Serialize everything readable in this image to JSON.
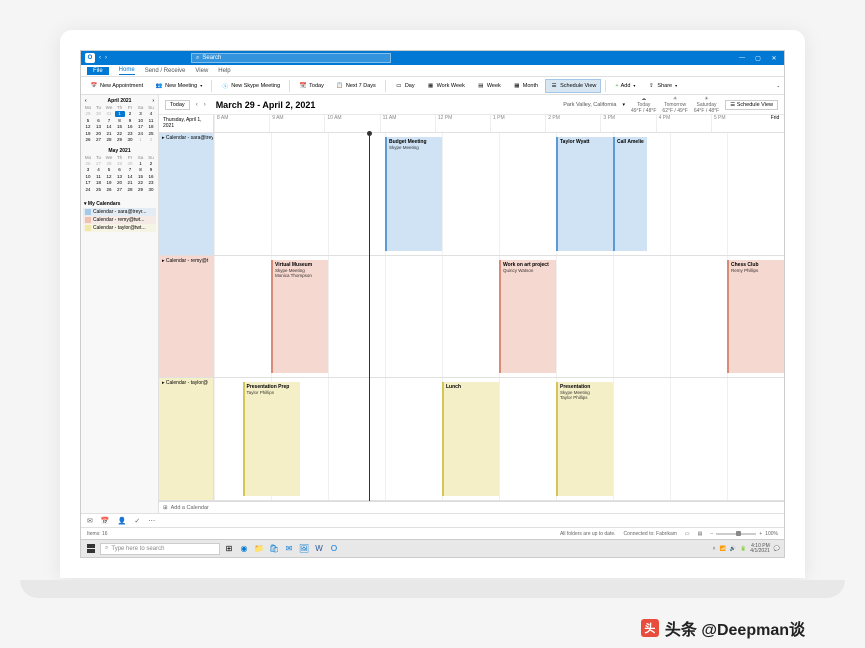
{
  "titlebar": {
    "search_placeholder": "Search"
  },
  "tabs": {
    "file": "File",
    "home": "Home",
    "send_receive": "Send / Receive",
    "view": "View",
    "help": "Help"
  },
  "ribbon": {
    "new_appointment": "New Appointment",
    "new_meeting": "New Meeting",
    "new_skype": "New Skype Meeting",
    "today": "Today",
    "next7": "Next 7 Days",
    "day": "Day",
    "work_week": "Work Week",
    "week": "Week",
    "month": "Month",
    "schedule_view": "Schedule View",
    "add": "Add",
    "share": "Share"
  },
  "minical1": {
    "title": "April 2021",
    "dow": [
      "Mo",
      "Tu",
      "We",
      "Th",
      "Fr",
      "Sa",
      "Su"
    ],
    "days": [
      {
        "n": "29",
        "dim": true
      },
      {
        "n": "30",
        "dim": true
      },
      {
        "n": "31",
        "dim": true
      },
      {
        "n": "1",
        "sel": true
      },
      {
        "n": "2"
      },
      {
        "n": "3"
      },
      {
        "n": "4"
      },
      {
        "n": "5"
      },
      {
        "n": "6"
      },
      {
        "n": "7"
      },
      {
        "n": "8"
      },
      {
        "n": "9"
      },
      {
        "n": "10"
      },
      {
        "n": "11"
      },
      {
        "n": "12"
      },
      {
        "n": "13"
      },
      {
        "n": "14"
      },
      {
        "n": "15"
      },
      {
        "n": "16"
      },
      {
        "n": "17"
      },
      {
        "n": "18"
      },
      {
        "n": "19"
      },
      {
        "n": "20"
      },
      {
        "n": "21"
      },
      {
        "n": "22"
      },
      {
        "n": "23"
      },
      {
        "n": "24"
      },
      {
        "n": "25"
      },
      {
        "n": "26"
      },
      {
        "n": "27"
      },
      {
        "n": "28"
      },
      {
        "n": "29"
      },
      {
        "n": "30"
      },
      {
        "n": "1",
        "dim": true
      },
      {
        "n": "2",
        "dim": true
      }
    ]
  },
  "minical2": {
    "title": "May 2021",
    "dow": [
      "Mo",
      "Tu",
      "We",
      "Th",
      "Fr",
      "Sa",
      "Su"
    ],
    "days": [
      {
        "n": "26",
        "dim": true
      },
      {
        "n": "27",
        "dim": true
      },
      {
        "n": "28",
        "dim": true
      },
      {
        "n": "29",
        "dim": true
      },
      {
        "n": "30",
        "dim": true
      },
      {
        "n": "1"
      },
      {
        "n": "2"
      },
      {
        "n": "3"
      },
      {
        "n": "4"
      },
      {
        "n": "5"
      },
      {
        "n": "6"
      },
      {
        "n": "7"
      },
      {
        "n": "8"
      },
      {
        "n": "9"
      },
      {
        "n": "10"
      },
      {
        "n": "11"
      },
      {
        "n": "12"
      },
      {
        "n": "13"
      },
      {
        "n": "14"
      },
      {
        "n": "15"
      },
      {
        "n": "16"
      },
      {
        "n": "17"
      },
      {
        "n": "18"
      },
      {
        "n": "19"
      },
      {
        "n": "20"
      },
      {
        "n": "21"
      },
      {
        "n": "22"
      },
      {
        "n": "23"
      },
      {
        "n": "24"
      },
      {
        "n": "25"
      },
      {
        "n": "26"
      },
      {
        "n": "27"
      },
      {
        "n": "28"
      },
      {
        "n": "29"
      },
      {
        "n": "30"
      }
    ]
  },
  "mycals": {
    "title": "My Calendars",
    "items": [
      {
        "label": "Calendar - sara@treyr...",
        "color": "#a5c8e8"
      },
      {
        "label": "Calendar - remy@twt...",
        "color": "#f0c0b0"
      },
      {
        "label": "Calendar - taylor@twt...",
        "color": "#f0e8a8"
      }
    ]
  },
  "main_head": {
    "today": "Today",
    "date_range": "March 29 - April 2, 2021",
    "current_day": "Thursday, April 1, 2021",
    "location": "Park Valley, California",
    "weather": [
      {
        "label": "Today",
        "temp": "49°F / 48°F",
        "icon": "☁"
      },
      {
        "label": "Tomorrow",
        "temp": "62°F / 49°F",
        "icon": "☀"
      },
      {
        "label": "Saturday",
        "temp": "64°F / 48°F",
        "icon": "☀"
      }
    ],
    "schedule_view": "Schedule View",
    "friday": "Frid"
  },
  "hours": [
    "8 AM",
    "9 AM",
    "10 AM",
    "11 AM",
    "12 PM",
    "1 PM",
    "2 PM",
    "3 PM",
    "4 PM",
    "5 PM"
  ],
  "rows": [
    {
      "label": "Calendar - sara@treyr",
      "color": "blue",
      "events": [
        {
          "title": "Budget Meeting",
          "sub": "Skype Meeting",
          "start": 3,
          "span": 1,
          "color": "blue"
        },
        {
          "title": "Taylor Wyatt",
          "sub": "",
          "start": 6,
          "span": 1,
          "color": "blue"
        },
        {
          "title": "Call Amelie",
          "sub": "",
          "start": 7,
          "span": 0.6,
          "color": "blue"
        }
      ]
    },
    {
      "label": "Calendar - remy@t",
      "color": "pink",
      "events": [
        {
          "title": "Virtual Museum",
          "sub": "Skype Meeting\nMonica Thompson",
          "start": 1,
          "span": 1,
          "color": "pink"
        },
        {
          "title": "Work on art project",
          "sub": "Quincy Watson",
          "start": 5,
          "span": 1,
          "color": "pink"
        },
        {
          "title": "Chess Club",
          "sub": "Remy Phillips",
          "start": 9,
          "span": 1,
          "color": "pink"
        }
      ]
    },
    {
      "label": "Calendar - taylor@",
      "color": "yellow",
      "events": [
        {
          "title": "Presentation Prep",
          "sub": "Taylor Phillips",
          "start": 0.5,
          "span": 1,
          "color": "yellow"
        },
        {
          "title": "Lunch",
          "sub": "",
          "start": 4,
          "span": 1,
          "color": "yellow"
        },
        {
          "title": "Presentation",
          "sub": "Skype Meeting\nTaylor Phillips",
          "start": 6,
          "span": 1,
          "color": "yellow"
        }
      ]
    }
  ],
  "add_calendar": "Add a Calendar",
  "statusbar": {
    "items": "Items: 16",
    "folders": "All folders are up to date.",
    "connected": "Connected to: Fabrikam",
    "zoom": "100%"
  },
  "taskbar": {
    "search_placeholder": "Type here to search",
    "time": "4:10 PM",
    "date": "4/1/2021"
  },
  "watermark": "头条 @Deepman谈"
}
